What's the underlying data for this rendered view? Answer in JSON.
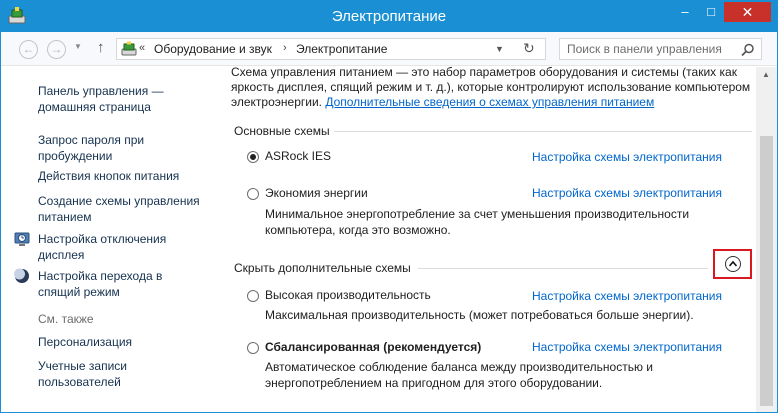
{
  "window": {
    "title": "Электропитание",
    "controls": {
      "minimize": "–",
      "maximize": "□",
      "close": "✕"
    }
  },
  "navigation": {
    "back_glyph": "←",
    "forward_glyph": "→",
    "recent_glyph": "▼",
    "up_glyph": "↑",
    "breadcrumb_prefix": "«",
    "breadcrumb": [
      "Оборудование и звук",
      "Электропитание"
    ],
    "separator": "›",
    "dropdown_glyph": "▼",
    "refresh_glyph": "↻",
    "search_placeholder": "Поиск в панели управления"
  },
  "sidebar": {
    "home": "Панель управления —\nдомашняя страница",
    "links": [
      "Запрос пароля при\nпробуждении",
      "Действия кнопок питания",
      "Создание схемы управления\nпитанием",
      "Настройка отключения\nдисплея",
      "Настройка перехода в\nспящий режим"
    ],
    "see_also": "См. также",
    "see_also_links": [
      "Персонализация",
      "Учетные записи\nпользователей"
    ]
  },
  "content": {
    "intro_text": "Схема управления питанием — это набор параметров оборудования и системы (таких как яркость дисплея, спящий режим и т. д.), которые контролируют использование компьютером электроэнергии. ",
    "intro_link": "Дополнительные сведения о схемах управления питанием",
    "main_schemes_heading": "Основные схемы",
    "hidden_schemes_heading": "Скрыть дополнительные схемы",
    "configure_link": "Настройка схемы электропитания",
    "plans": [
      {
        "name": "ASRock IES",
        "checked": true,
        "desc": ""
      },
      {
        "name": "Экономия энергии",
        "checked": false,
        "desc": "Минимальное энергопотребление за счет уменьшения производительности компьютера, когда это возможно."
      },
      {
        "name": "Высокая производительность",
        "checked": false,
        "desc": "Максимальная производительность (может потребоваться больше энергии)."
      },
      {
        "name": "Сбалансированная (рекомендуется)",
        "checked": false,
        "desc": "Автоматическое соблюдение баланса между производительностью и энергопотреблением на пригодном для этого оборудовании."
      }
    ]
  },
  "scrollbar": {
    "up_glyph": "▲"
  },
  "colors": {
    "titlebar": "#1b8fd3",
    "close_button": "#c7312a",
    "link": "#0066cc",
    "highlight_box": "#d9171e"
  }
}
